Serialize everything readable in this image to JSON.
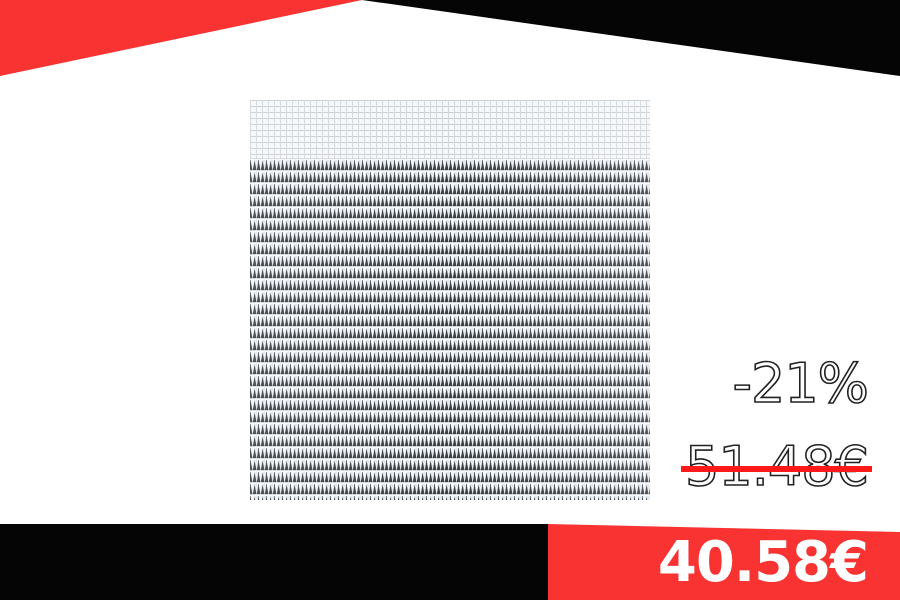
{
  "colors": {
    "accent_red": "#f93232",
    "band_black": "#050505",
    "background": "#ffffff",
    "strike_red": "#ff1a1a"
  },
  "product": {
    "image_icon": "white-shade-net-mesh-icon"
  },
  "pricing": {
    "discount_label": "-21%",
    "old_price": "51.48€",
    "new_price": "40.58€"
  }
}
